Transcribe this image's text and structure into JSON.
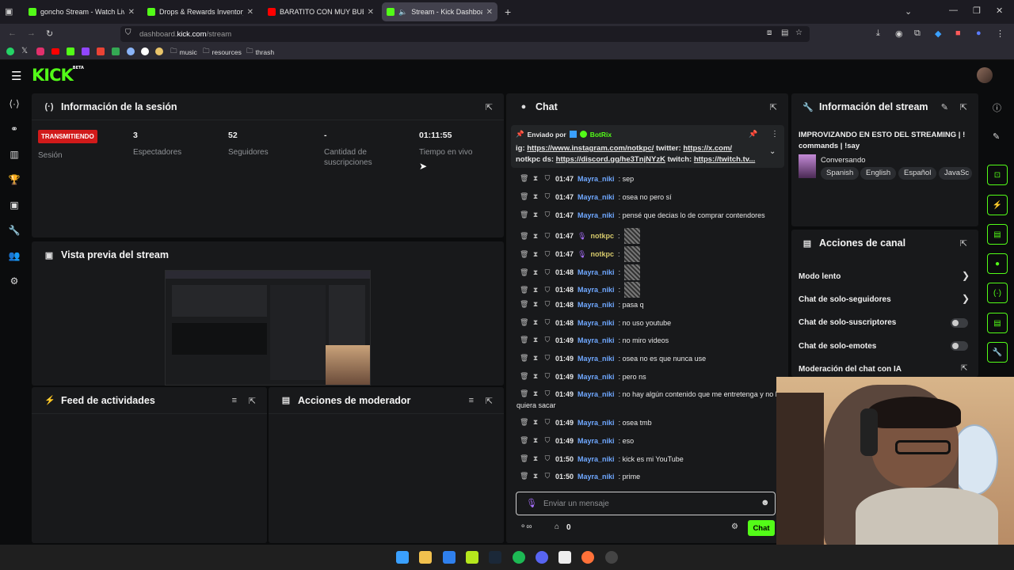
{
  "browser": {
    "tabs": [
      {
        "title": "goncho Stream - Watch Live on",
        "color": "#53fc18"
      },
      {
        "title": "Drops & Rewards Inventory - Ki",
        "color": "#53fc18"
      },
      {
        "title": "BARATITO CON MUY BUENAS S",
        "color": "#ff0000"
      },
      {
        "title": "Stream - Kick Dashboard",
        "color": "#53fc18"
      }
    ],
    "url_prefix": "dashboard.",
    "url_domain": "kick.com",
    "url_path": "/stream",
    "bookmarks": [
      "music",
      "resources",
      "thrash"
    ]
  },
  "app": {
    "logo": "KICK",
    "logo_badge": "BETA"
  },
  "session": {
    "title": "Información de la sesión",
    "badge": "TRANSMITIENDO",
    "badge_label": "Sesión",
    "viewers_value": "3",
    "viewers_label": "Espectadores",
    "followers_value": "52",
    "followers_label": "Seguidores",
    "subs_value": "-",
    "subs_label_1": "Cantidad de",
    "subs_label_2": "suscripciones",
    "time_value": "01:11:55",
    "time_label": "Tiempo en vivo"
  },
  "preview": {
    "title": "Vista previa del stream"
  },
  "feed": {
    "title": "Feed de actividades"
  },
  "mod": {
    "title": "Acciones de moderador"
  },
  "chat": {
    "title": "Chat",
    "pinned": {
      "sent_by": "Enviado por",
      "bot": "BotRix",
      "line1_a": "ig: ",
      "line1_link1": "https://www.instagram.com/notkpc/",
      "line1_b": " twitter: ",
      "line1_link2": "https://x.com/",
      "line2_a": "notkpc ds: ",
      "line2_link1": "https://discord.gg/he3TnjNYzK",
      "line2_b": " twitch: ",
      "line2_link2": "https://twitch.tv..."
    },
    "messages": [
      {
        "time": "01:47",
        "user": "Mayra_niki",
        "text": ": sep"
      },
      {
        "time": "01:47",
        "user": "Mayra_niki",
        "text": ": osea no pero sí"
      },
      {
        "time": "01:47",
        "user": "Mayra_niki",
        "text": ": pensé que decias lo de comprar contendores"
      },
      {
        "time": "01:47",
        "user": "notkpc",
        "text": ":"
      },
      {
        "time": "01:47",
        "user": "notkpc",
        "text": ":"
      },
      {
        "time": "01:48",
        "user": "Mayra_niki",
        "text": ":"
      },
      {
        "time": "01:48",
        "user": "Mayra_niki",
        "text": ":"
      },
      {
        "time": "01:48",
        "user": "Mayra_niki",
        "text": ": pasa q"
      },
      {
        "time": "01:48",
        "user": "Mayra_niki",
        "text": ": no uso youtube"
      },
      {
        "time": "01:49",
        "user": "Mayra_niki",
        "text": ": no miro videos"
      },
      {
        "time": "01:49",
        "user": "Mayra_niki",
        "text": ": osea no es que nunca use"
      },
      {
        "time": "01:49",
        "user": "Mayra_niki",
        "text": ": pero ns"
      },
      {
        "time": "01:49",
        "user": "Mayra_niki",
        "text": ": no hay algún contenido que me entretenga y no lo"
      },
      {
        "time": "01:49",
        "user": "Mayra_niki",
        "text": ": osea tmb"
      },
      {
        "time": "01:49",
        "user": "Mayra_niki",
        "text": ": eso"
      },
      {
        "time": "01:50",
        "user": "Mayra_niki",
        "text": ": kick es mi YouTube"
      },
      {
        "time": "01:50",
        "user": "Mayra_niki",
        "text": ": prime"
      }
    ],
    "wrap_text": "quiera sacar",
    "input_placeholder": "Enviar un mensaje",
    "points": "0",
    "send_label": "Chat"
  },
  "stream_info": {
    "title": "Información del stream",
    "stream_title_1": "IMPROVIZANDO EN ESTO DEL STREAMING | !",
    "stream_title_2": "commands | !say",
    "category": "Conversando",
    "tags": [
      "Spanish",
      "English",
      "Español",
      "JavaSc"
    ]
  },
  "channel_actions": {
    "title": "Acciones de canal",
    "items": [
      "Modo lento",
      "Chat de solo-seguidores",
      "Chat de solo-suscriptores",
      "Chat de solo-emotes",
      "Moderación del chat con IA"
    ]
  }
}
